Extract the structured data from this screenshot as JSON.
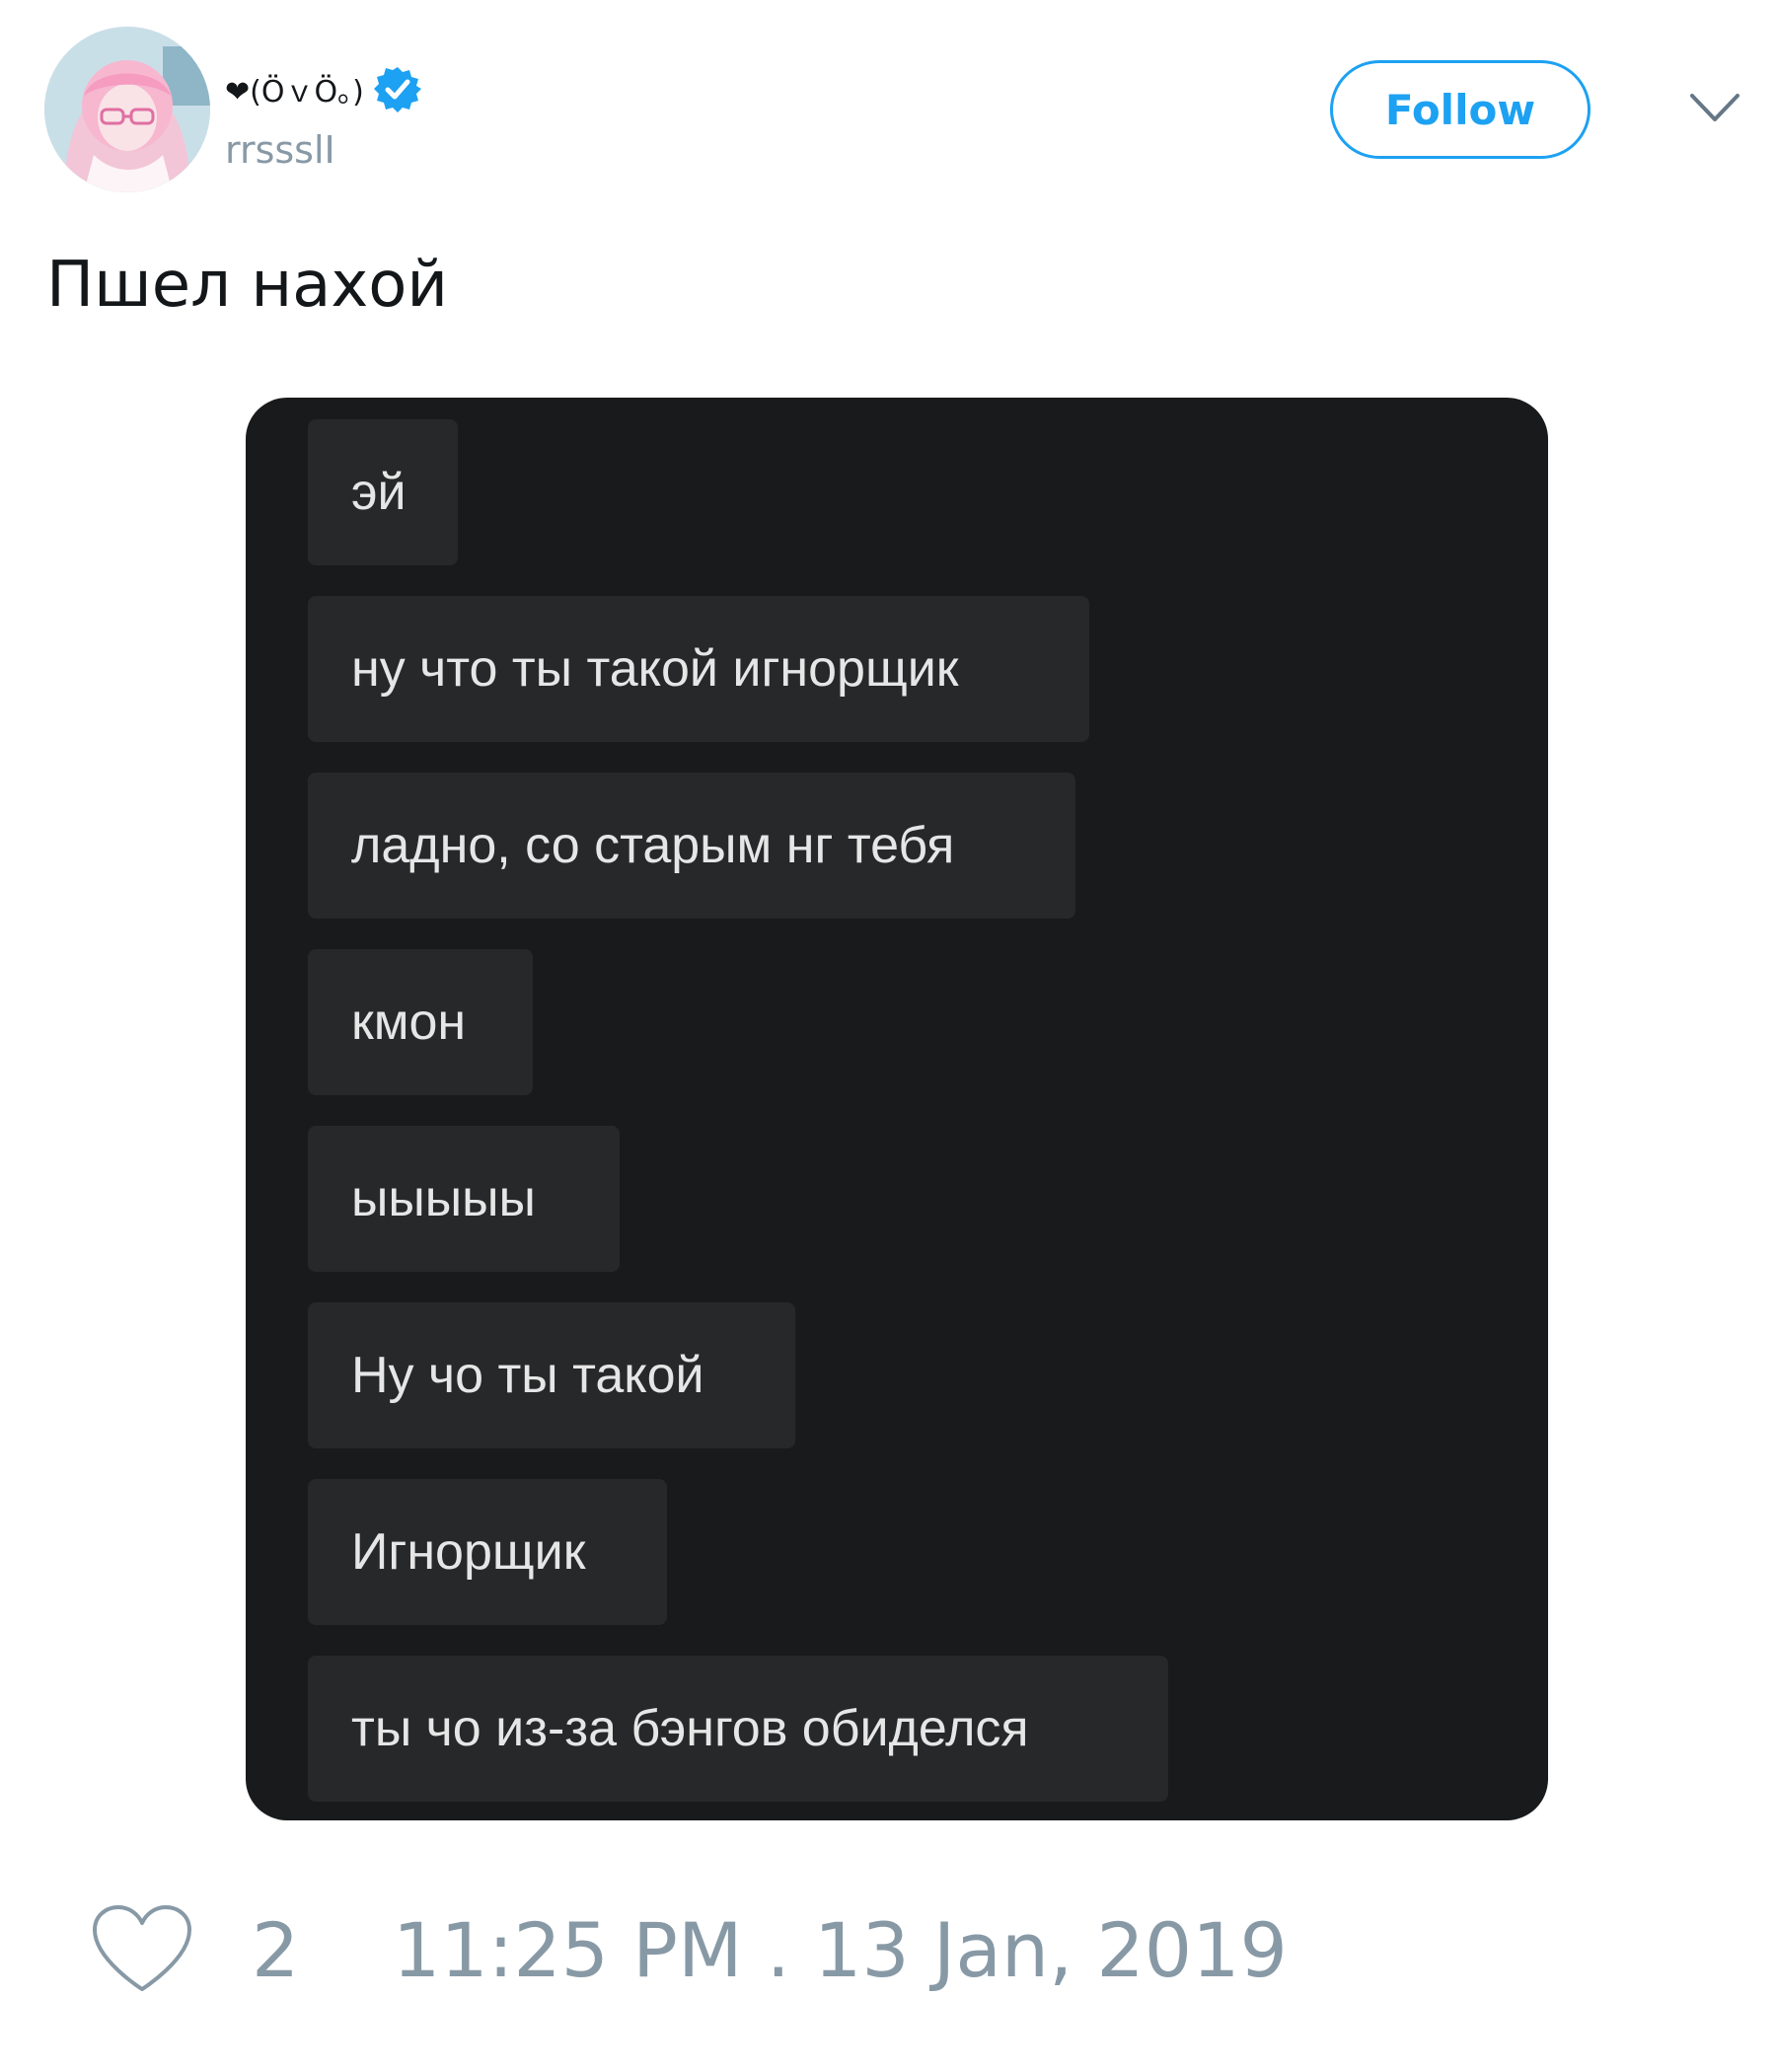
{
  "user": {
    "display_name": "❤(ӦｖӦ｡)",
    "handle": "rrssslI",
    "verified": true,
    "avatar_icon": "anime-avatar-icon"
  },
  "header": {
    "follow_label": "Follow",
    "menu_icon": "chevron-down-icon"
  },
  "tweet": {
    "text": "Пшел нахой"
  },
  "media": {
    "messages": [
      "эй",
      "ну что ты такой игнорщик",
      "ладно, со старым нг тебя",
      "кмон",
      "ыыыыы",
      "Ну чо ты такой",
      "Игнорщик",
      "ты чо из-за бэнгов обиделся"
    ]
  },
  "footer": {
    "like_count": "2",
    "timestamp": "11:25 PM . 13 Jan, 2019",
    "like_icon": "heart-icon"
  },
  "colors": {
    "accent": "#1da1f2",
    "muted": "#8899a6",
    "media_bg": "#191a1b",
    "bubble_bg": "#262829"
  }
}
